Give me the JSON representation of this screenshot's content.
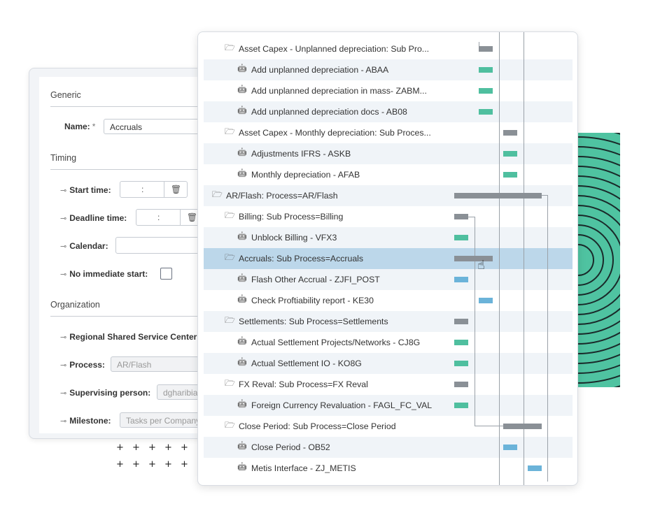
{
  "form": {
    "generic_title": "Generic",
    "name_label": "Name:",
    "name_required": "*",
    "name_value": "Accruals",
    "timing_title": "Timing",
    "start_time_label": "Start time:",
    "deadline_time_label": "Deadline time:",
    "time_separator": ":",
    "calendar_label": "Calendar:",
    "no_immediate_start_label": "No immediate start:",
    "organization_title": "Organization",
    "regional_label": "Regional Shared Service Center",
    "process_label": "Process:",
    "process_value": "AR/Flash",
    "supervising_label": "Supervising person:",
    "supervising_value": "dgharibia",
    "milestone_label": "Milestone:",
    "milestone_placeholder": "Tasks per Company"
  },
  "gantt": {
    "rows": [
      {
        "label": "Asset Capex - Unplanned depreciation: Sub Pro...",
        "type": "folder"
      },
      {
        "label": "Add unplanned depreciation - ABAA",
        "type": "task"
      },
      {
        "label": "Add unplanned depreciation in mass- ZABM...",
        "type": "task"
      },
      {
        "label": "Add unplanned depreciation docs - AB08",
        "type": "task"
      },
      {
        "label": "Asset Capex - Monthly depreciation: Sub Proces...",
        "type": "folder"
      },
      {
        "label": "Adjustments IFRS - ASKB",
        "type": "task"
      },
      {
        "label": "Monthly depreciation - AFAB",
        "type": "task"
      },
      {
        "label": "AR/Flash: Process=AR/Flash",
        "type": "folder"
      },
      {
        "label": "Billing: Sub Process=Billing",
        "type": "folder"
      },
      {
        "label": "Unblock Billing - VFX3",
        "type": "task"
      },
      {
        "label": "Accruals: Sub Process=Accruals",
        "type": "folder"
      },
      {
        "label": "Flash Other Accrual - ZJFI_POST",
        "type": "task"
      },
      {
        "label": "Check Proftiability report - KE30",
        "type": "task"
      },
      {
        "label": "Settlements: Sub Process=Settlements",
        "type": "folder"
      },
      {
        "label": "Actual Settlement Projects/Networks - CJ8G",
        "type": "task"
      },
      {
        "label": "Actual Settlement IO - KO8G",
        "type": "task"
      },
      {
        "label": "FX Reval: Sub Process=FX Reval",
        "type": "folder"
      },
      {
        "label": "Foreign Currency Revaluation - FAGL_FC_VAL",
        "type": "task"
      },
      {
        "label": "Close Period: Sub Process=Close Period",
        "type": "folder"
      },
      {
        "label": "Close Period - OB52",
        "type": "task"
      },
      {
        "label": "Metis Interface - ZJ_METIS",
        "type": "task"
      }
    ]
  },
  "icons": {
    "folder": "folder-open-icon",
    "task": "robot-icon",
    "key": "key-icon",
    "trash": "trash-icon",
    "cursor": "hand-pointer-icon"
  },
  "colors": {
    "summary_bar": "#8a9096",
    "task_bar_done": "#4fbf9f",
    "task_bar_pending": "#6bb3d9",
    "selected_row": "#bcd7ea",
    "accent_deco": "#4fc3a1"
  }
}
